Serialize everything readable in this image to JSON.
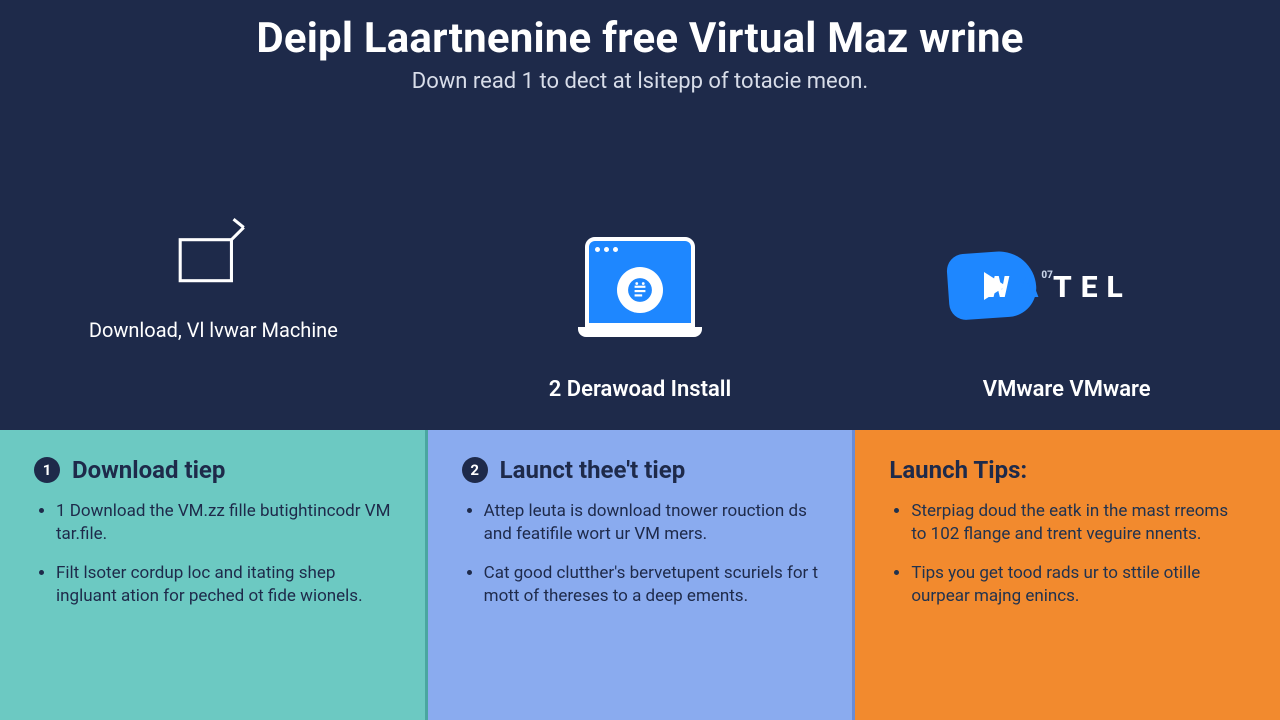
{
  "hero": {
    "title": "Deipl Laartnenine free Virtual Maz wrine",
    "subtitle": "Down read 1 to dect at lsitepp of totacie meon."
  },
  "features": [
    {
      "icon": "folder-flag-icon",
      "label": "Download, Vl lvwar Machine"
    },
    {
      "icon": "laptop-list-icon",
      "label": "2 Derawoad Install"
    },
    {
      "icon": "watel-logo-icon",
      "label": "VMware VMware"
    }
  ],
  "logo": {
    "text_pre": "W",
    "text_accent": "A",
    "text_post": "TEL",
    "sup": "07"
  },
  "cards": [
    {
      "badge": "1",
      "heading": "Download tiep",
      "bullets": [
        "1 Download the VM.zz fille butightincodr VM tar.file.",
        "Filt lsoter cordup loc and itating shep ingluant ation for peched ot fide wionels."
      ]
    },
    {
      "badge": "2",
      "heading": "Launct thee't tiep",
      "bullets": [
        "Attep leuta is download tnower rouction ds and featifile wort ur VM mers.",
        "Cat good clutther's bervetupent scuriels for t mott of thereses to a deep ements."
      ]
    },
    {
      "badge": "",
      "heading": "Launch Tips:",
      "bullets": [
        "Sterpiag doud the eatk in the mast rreoms to 102 flange and trent veguire nnents.",
        "Tips you get tood rads ur to sttile otille ourpear majng enincs."
      ]
    }
  ]
}
